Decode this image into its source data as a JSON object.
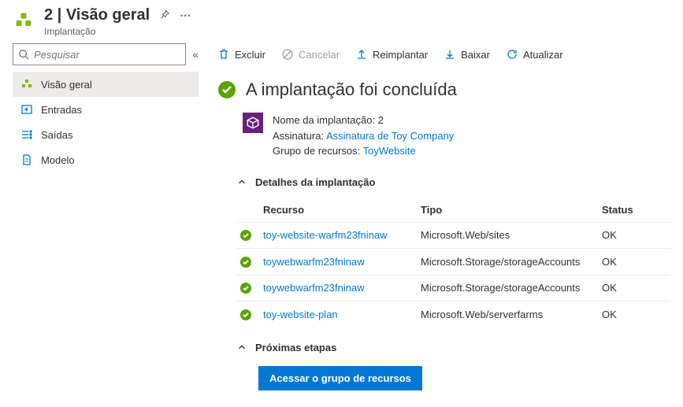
{
  "header": {
    "title": "2 | Visão geral",
    "subtitle": "Implantação"
  },
  "search": {
    "placeholder": "Pesquisar"
  },
  "nav": {
    "items": [
      {
        "label": "Visão geral"
      },
      {
        "label": "Entradas"
      },
      {
        "label": "Saídas"
      },
      {
        "label": "Modelo"
      }
    ]
  },
  "toolbar": {
    "delete": "Excluir",
    "cancel": "Cancelar",
    "redeploy": "Reimplantar",
    "download": "Baixar",
    "refresh": "Atualizar"
  },
  "status": {
    "title": "A implantação foi concluída"
  },
  "info": {
    "name_label": "Nome da implantação:",
    "name_value": "2",
    "sub_label": "Assinatura:",
    "sub_value": "Assinatura de Toy Company",
    "rg_label": "Grupo de recursos:",
    "rg_value": "ToyWebsite"
  },
  "sections": {
    "details_title": "Detalhes da implantação",
    "next_title": "Próximas etapas"
  },
  "table": {
    "headers": {
      "resource": "Recurso",
      "type": "Tipo",
      "status": "Status"
    },
    "rows": [
      {
        "resource": "toy-website-warfm23fninaw",
        "type": "Microsoft.Web/sites",
        "status": "OK"
      },
      {
        "resource": "toywebwarfm23fninaw",
        "type": "Microsoft.Storage/storageAccounts",
        "status": "OK"
      },
      {
        "resource": "toywebwarfm23fninaw",
        "type": "Microsoft.Storage/storageAccounts",
        "status": "OK"
      },
      {
        "resource": "toy-website-plan",
        "type": "Microsoft.Web/serverfarms",
        "status": "OK"
      }
    ]
  },
  "buttons": {
    "go_to_rg": "Acessar o grupo de recursos"
  }
}
